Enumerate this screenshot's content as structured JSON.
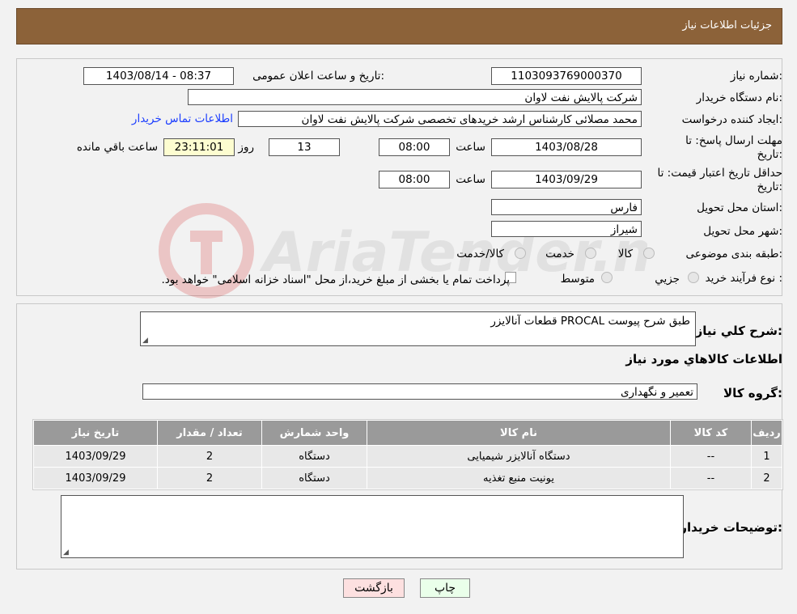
{
  "header": {
    "title": "جزئیات اطلاعات نیاز"
  },
  "form": {
    "need_number_label": "شماره نیاز:",
    "need_number": "1103093769000370",
    "announce_label": "تاریخ و ساعت اعلان عمومی:",
    "announce_value": "1403/08/14 - 08:37",
    "buyer_org_label": "نام دستگاه خریدار:",
    "buyer_org": "شرکت پالایش نفت لاوان",
    "creator_label": "ایجاد کننده درخواست:",
    "creator": "محمد مصلائی کارشناس ارشد خریدهای تخصصی شرکت پالایش نفت لاوان",
    "buyer_contact_link": "اطلاعات تماس خریدار",
    "deadline_label": "مهلت ارسال پاسخ: تا تاریخ:",
    "deadline_date": "1403/08/28",
    "time_label": "ساعت",
    "deadline_time": "08:00",
    "days_value": "13",
    "days_label": "روز و",
    "remaining_time": "23:11:01",
    "remaining_label": "ساعت باقي مانده",
    "validity_label": "حداقل تاریخ اعتبار قیمت: تا تاریخ:",
    "validity_date": "1403/09/29",
    "validity_time": "08:00",
    "province_label": "استان محل تحویل:",
    "province": "فارس",
    "city_label": "شهر محل تحویل:",
    "city": "شیراز",
    "category_label": "طبقه بندی موضوعی:",
    "category_options": [
      "کالا",
      "خدمت",
      "کالا/خدمت"
    ],
    "process_label": "نوع فرآیند خرید :",
    "process_options": [
      "جزیي",
      "متوسط"
    ],
    "process_note": "پرداخت تمام یا بخشی از مبلغ خرید،از محل \"اسناد خزانه اسلامی\" خواهد بود."
  },
  "details": {
    "desc_label": "شرح کلي نياز:",
    "desc_value": "قطعات آنالایزر PROCAL طبق شرح پیوست",
    "goods_title": "اطلاعات کالاهاي مورد نياز",
    "group_label": "گروه کالا:",
    "group_value": "تعمیر و نگهداری",
    "table_headers": [
      "رديف",
      "کد کالا",
      "نام کالا",
      "واحد شمارش",
      "تعداد / مقدار",
      "تاریخ نیاز"
    ],
    "rows": [
      [
        "1",
        "--",
        "دستگاه آنالایزر شیمیایی",
        "دستگاه",
        "2",
        "1403/09/29"
      ],
      [
        "2",
        "--",
        "یونیت منبع تغذیه",
        "دستگاه",
        "2",
        "1403/09/29"
      ]
    ],
    "buyer_notes_label": "توضیحات خریدار:",
    "buyer_notes_value": ""
  },
  "buttons": {
    "print": "چاپ",
    "back": "بازگشت"
  },
  "watermark": {
    "text": "AriaTender.neT"
  },
  "colors": {
    "header_bg": "#8c6239",
    "link": "#1a3cff",
    "table_header": "#9a9a9a",
    "back_btn": "#fde0e0",
    "print_btn": "#eaffea"
  }
}
